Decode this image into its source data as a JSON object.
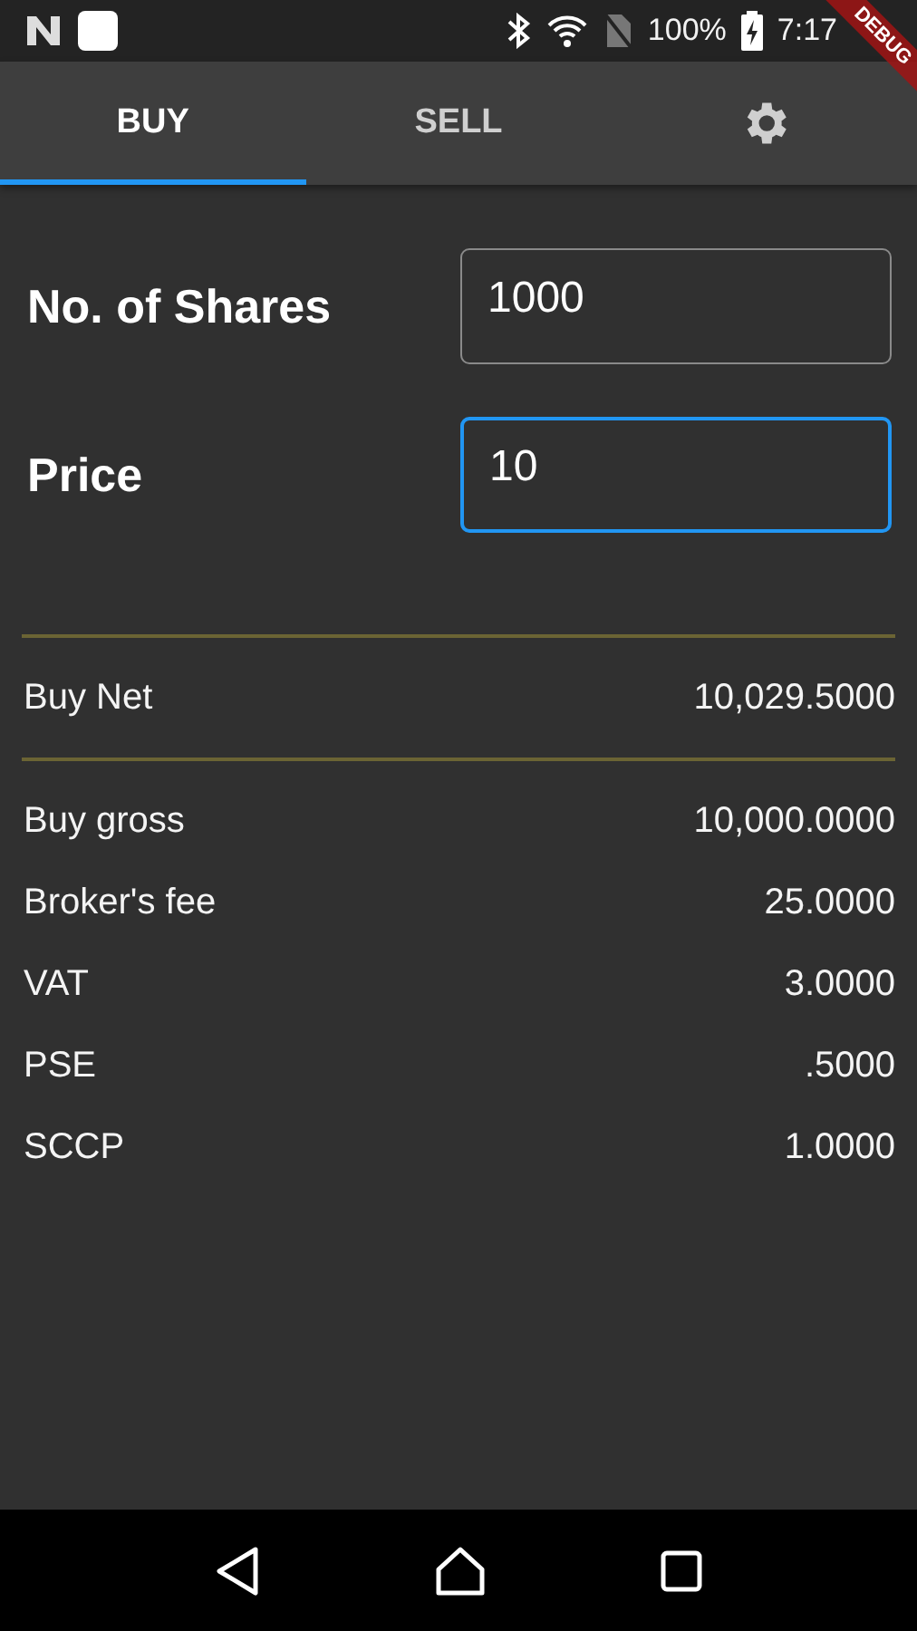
{
  "status_bar": {
    "battery": "100%",
    "time": "7:17"
  },
  "debug_banner": "DEBUG",
  "tabs": [
    {
      "label": "BUY",
      "selected": true
    },
    {
      "label": "SELL",
      "selected": false
    }
  ],
  "fields": [
    {
      "label": "No. of Shares",
      "value": "1000",
      "focused": false
    },
    {
      "label": "Price",
      "value": "10",
      "focused": true
    }
  ],
  "summary": {
    "label": "Buy Net",
    "value": "10,029.5000"
  },
  "breakdown": [
    {
      "label": "Buy gross",
      "value": "10,000.0000"
    },
    {
      "label": "Broker's fee",
      "value": "25.0000"
    },
    {
      "label": "VAT",
      "value": "3.0000"
    },
    {
      "label": "PSE",
      "value": ".5000"
    },
    {
      "label": "SCCP",
      "value": "1.0000"
    }
  ]
}
